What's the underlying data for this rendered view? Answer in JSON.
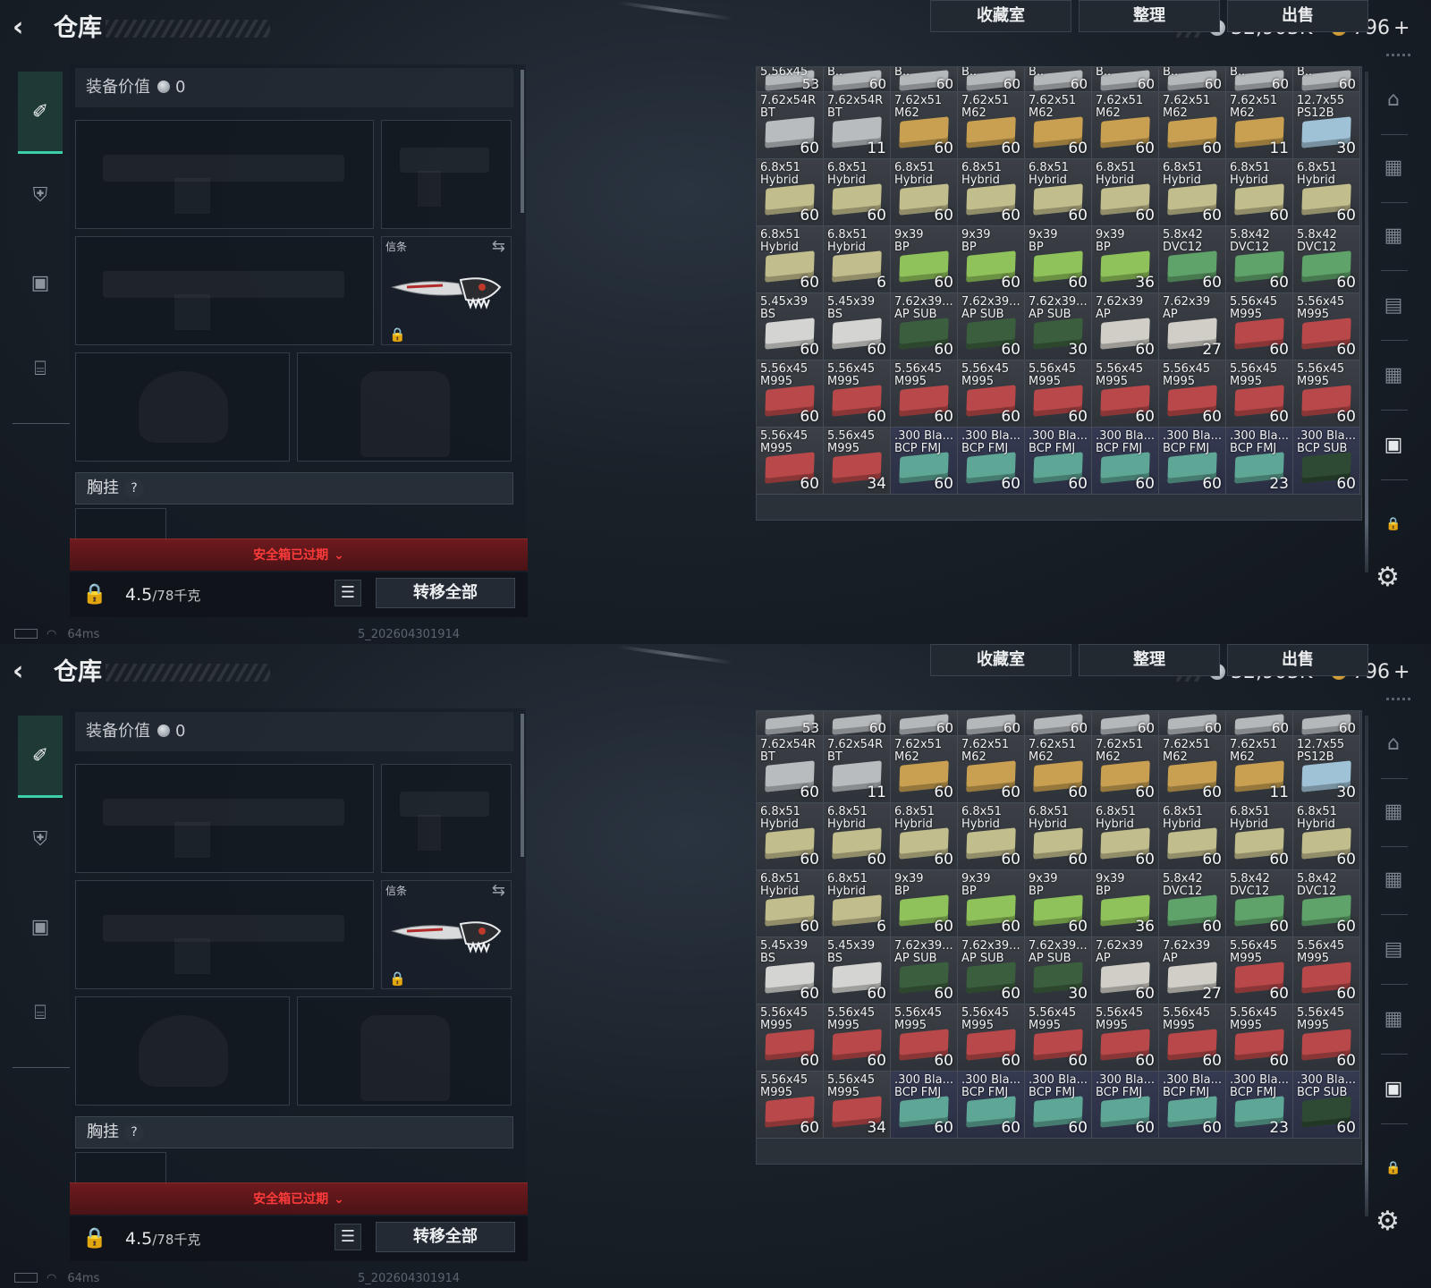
{
  "header": {
    "title": "仓库",
    "silver": "32,903K",
    "gold": "796",
    "gold_plus": "+"
  },
  "equipment": {
    "value_label": "装备价值",
    "value": "0",
    "knife_label": "信条",
    "chest_label": "胸挂",
    "chest_help": "?"
  },
  "warning": {
    "text": "安全箱已过期",
    "chevron": "⌄"
  },
  "weight": {
    "current": "4.5",
    "max": "/78",
    "unit": "千克"
  },
  "buttons": {
    "transfer_all": "转移全部",
    "collection": "收藏室",
    "organize": "整理",
    "sell": "出售"
  },
  "status": {
    "ping": "64ms",
    "version": "5_202604301914"
  },
  "grid_top_row_p0": [
    {
      "n1": "5.56x45",
      "cnt": "53"
    },
    {
      "n1": "B..",
      "cnt": "60"
    },
    {
      "n1": "B..",
      "cnt": "60"
    },
    {
      "n1": "B..",
      "cnt": "60"
    },
    {
      "n1": "B..",
      "cnt": "60"
    },
    {
      "n1": "B..",
      "cnt": "60"
    },
    {
      "n1": "B..",
      "cnt": "60"
    },
    {
      "n1": "B..",
      "cnt": "60"
    },
    {
      "n1": "B..",
      "cnt": "60"
    }
  ],
  "grid_top_row_p1": [
    {
      "n1": "",
      "cnt": "53"
    },
    {
      "n1": "",
      "cnt": "60"
    },
    {
      "n1": "",
      "cnt": "60"
    },
    {
      "n1": "",
      "cnt": "60"
    },
    {
      "n1": "",
      "cnt": "60"
    },
    {
      "n1": "",
      "cnt": "60"
    },
    {
      "n1": "",
      "cnt": "60"
    },
    {
      "n1": "",
      "cnt": "60"
    },
    {
      "n1": "",
      "cnt": "60"
    }
  ],
  "grid": [
    [
      {
        "n1": "7.62x54R",
        "n2": "BT",
        "cnt": "60",
        "c": "#b8bcbf"
      },
      {
        "n1": "7.62x54R",
        "n2": "BT",
        "cnt": "11",
        "c": "#b8bcbf"
      },
      {
        "n1": "7.62x51",
        "n2": "M62",
        "cnt": "60",
        "c": "#c9a052"
      },
      {
        "n1": "7.62x51",
        "n2": "M62",
        "cnt": "60",
        "c": "#c9a052"
      },
      {
        "n1": "7.62x51",
        "n2": "M62",
        "cnt": "60",
        "c": "#c9a052"
      },
      {
        "n1": "7.62x51",
        "n2": "M62",
        "cnt": "60",
        "c": "#c9a052"
      },
      {
        "n1": "7.62x51",
        "n2": "M62",
        "cnt": "60",
        "c": "#c9a052"
      },
      {
        "n1": "7.62x51",
        "n2": "M62",
        "cnt": "11",
        "c": "#c9a052"
      },
      {
        "n1": "12.7x55",
        "n2": "PS12B",
        "cnt": "30",
        "c": "#9fc2d6"
      }
    ],
    [
      {
        "n1": "6.8x51",
        "n2": "Hybrid",
        "cnt": "60",
        "c": "#c2bd8c"
      },
      {
        "n1": "6.8x51",
        "n2": "Hybrid",
        "cnt": "60",
        "c": "#c2bd8c"
      },
      {
        "n1": "6.8x51",
        "n2": "Hybrid",
        "cnt": "60",
        "c": "#c2bd8c"
      },
      {
        "n1": "6.8x51",
        "n2": "Hybrid",
        "cnt": "60",
        "c": "#c2bd8c"
      },
      {
        "n1": "6.8x51",
        "n2": "Hybrid",
        "cnt": "60",
        "c": "#c2bd8c"
      },
      {
        "n1": "6.8x51",
        "n2": "Hybrid",
        "cnt": "60",
        "c": "#c2bd8c"
      },
      {
        "n1": "6.8x51",
        "n2": "Hybrid",
        "cnt": "60",
        "c": "#c2bd8c"
      },
      {
        "n1": "6.8x51",
        "n2": "Hybrid",
        "cnt": "60",
        "c": "#c2bd8c"
      },
      {
        "n1": "6.8x51",
        "n2": "Hybrid",
        "cnt": "60",
        "c": "#c2bd8c"
      }
    ],
    [
      {
        "n1": "6.8x51",
        "n2": "Hybrid",
        "cnt": "60",
        "c": "#c2bd8c"
      },
      {
        "n1": "6.8x51",
        "n2": "Hybrid",
        "cnt": "6",
        "c": "#c2bd8c"
      },
      {
        "n1": "9x39",
        "n2": "BP",
        "cnt": "60",
        "c": "#8fc25a"
      },
      {
        "n1": "9x39",
        "n2": "BP",
        "cnt": "60",
        "c": "#8fc25a"
      },
      {
        "n1": "9x39",
        "n2": "BP",
        "cnt": "60",
        "c": "#8fc25a"
      },
      {
        "n1": "9x39",
        "n2": "BP",
        "cnt": "36",
        "c": "#8fc25a"
      },
      {
        "n1": "5.8x42",
        "n2": "DVC12",
        "cnt": "60",
        "c": "#5fa36a"
      },
      {
        "n1": "5.8x42",
        "n2": "DVC12",
        "cnt": "60",
        "c": "#5fa36a"
      },
      {
        "n1": "5.8x42",
        "n2": "DVC12",
        "cnt": "60",
        "c": "#5fa36a"
      }
    ],
    [
      {
        "n1": "5.45x39",
        "n2": "BS",
        "cnt": "60",
        "c": "#d4d4d2"
      },
      {
        "n1": "5.45x39",
        "n2": "BS",
        "cnt": "60",
        "c": "#d4d4d2"
      },
      {
        "n1": "7.62x39...",
        "n2": "AP SUB",
        "cnt": "60",
        "c": "#3b5f3e"
      },
      {
        "n1": "7.62x39...",
        "n2": "AP SUB",
        "cnt": "60",
        "c": "#3b5f3e"
      },
      {
        "n1": "7.62x39...",
        "n2": "AP SUB",
        "cnt": "30",
        "c": "#3b5f3e"
      },
      {
        "n1": "7.62x39",
        "n2": "AP",
        "cnt": "60",
        "c": "#d0cec6"
      },
      {
        "n1": "7.62x39",
        "n2": "AP",
        "cnt": "27",
        "c": "#d0cec6"
      },
      {
        "n1": "5.56x45",
        "n2": "M995",
        "cnt": "60",
        "c": "#b8484a"
      },
      {
        "n1": "5.56x45",
        "n2": "M995",
        "cnt": "60",
        "c": "#b8484a"
      }
    ],
    [
      {
        "n1": "5.56x45",
        "n2": "M995",
        "cnt": "60",
        "c": "#b8484a"
      },
      {
        "n1": "5.56x45",
        "n2": "M995",
        "cnt": "60",
        "c": "#b8484a"
      },
      {
        "n1": "5.56x45",
        "n2": "M995",
        "cnt": "60",
        "c": "#b8484a"
      },
      {
        "n1": "5.56x45",
        "n2": "M995",
        "cnt": "60",
        "c": "#b8484a"
      },
      {
        "n1": "5.56x45",
        "n2": "M995",
        "cnt": "60",
        "c": "#b8484a"
      },
      {
        "n1": "5.56x45",
        "n2": "M995",
        "cnt": "60",
        "c": "#b8484a"
      },
      {
        "n1": "5.56x45",
        "n2": "M995",
        "cnt": "60",
        "c": "#b8484a"
      },
      {
        "n1": "5.56x45",
        "n2": "M995",
        "cnt": "60",
        "c": "#b8484a"
      },
      {
        "n1": "5.56x45",
        "n2": "M995",
        "cnt": "60",
        "c": "#b8484a"
      }
    ],
    [
      {
        "n1": "5.56x45",
        "n2": "M995",
        "cnt": "60",
        "c": "#b8484a"
      },
      {
        "n1": "5.56x45",
        "n2": "M995",
        "cnt": "34",
        "c": "#b8484a"
      },
      {
        "n1": ".300 Bla...",
        "n2": "BCP FMJ",
        "cnt": "60",
        "c": "#5ea696",
        "blue": true
      },
      {
        "n1": ".300 Bla...",
        "n2": "BCP FMJ",
        "cnt": "60",
        "c": "#5ea696",
        "blue": true
      },
      {
        "n1": ".300 Bla...",
        "n2": "BCP FMJ",
        "cnt": "60",
        "c": "#5ea696",
        "blue": true
      },
      {
        "n1": ".300 Bla...",
        "n2": "BCP FMJ",
        "cnt": "60",
        "c": "#5ea696",
        "blue": true
      },
      {
        "n1": ".300 Bla...",
        "n2": "BCP FMJ",
        "cnt": "60",
        "c": "#5ea696",
        "blue": true
      },
      {
        "n1": ".300 Bla...",
        "n2": "BCP FMJ",
        "cnt": "23",
        "c": "#5ea696",
        "blue": true
      },
      {
        "n1": ".300 Bla...",
        "n2": "BCP SUB",
        "cnt": "60",
        "c": "#2f4a34",
        "blue": true
      }
    ]
  ],
  "right_nav": [
    {
      "icon": "backpack-icon",
      "glyph": "⌂"
    },
    {
      "icon": "case-iv-icon",
      "glyph": "▦"
    },
    {
      "icon": "case-iv-2-icon",
      "glyph": "▦"
    },
    {
      "icon": "case-iii-icon",
      "glyph": "▤"
    },
    {
      "icon": "case-iv-3-icon",
      "glyph": "▦"
    },
    {
      "icon": "case-iv-active-icon",
      "glyph": "▣"
    },
    {
      "icon": "lock-icon",
      "glyph": "🔒"
    }
  ]
}
